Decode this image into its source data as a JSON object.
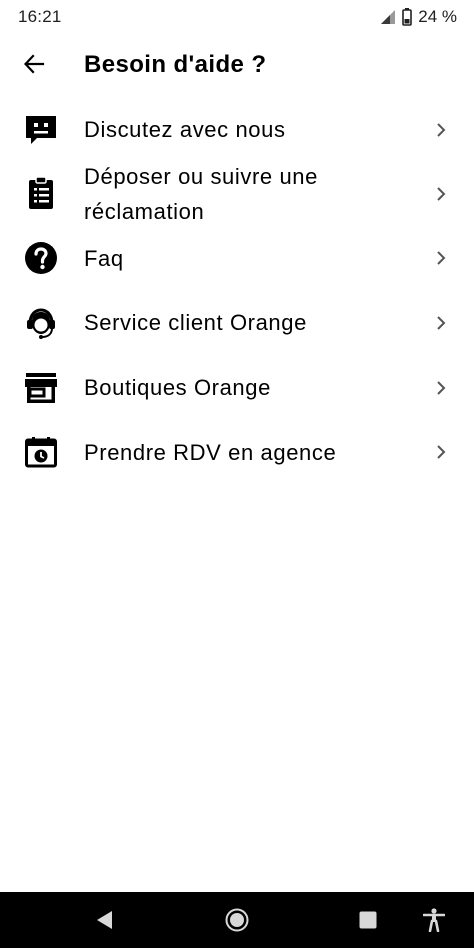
{
  "status_bar": {
    "time": "16:21",
    "battery_percent": "24 %",
    "icons": [
      "signal-icon",
      "battery-icon"
    ]
  },
  "header": {
    "title": "Besoin d'aide ?",
    "back_icon": "arrow-left-icon"
  },
  "menu": {
    "items": [
      {
        "label": "Discutez avec nous",
        "icon": "chat-bubble-icon"
      },
      {
        "label": "Déposer ou suivre une réclamation",
        "icon": "clipboard-icon"
      },
      {
        "label": "Faq",
        "icon": "help-circle-icon"
      },
      {
        "label": "Service client Orange",
        "icon": "headset-agent-icon"
      },
      {
        "label": "Boutiques Orange",
        "icon": "store-icon"
      },
      {
        "label": "Prendre RDV en agence",
        "icon": "calendar-clock-icon"
      }
    ],
    "chevron_icon": "chevron-right-icon"
  },
  "nav_bar": {
    "icons": [
      "back-triangle-icon",
      "home-circle-icon",
      "recents-square-icon",
      "accessibility-icon"
    ]
  },
  "colors": {
    "background": "#ffffff",
    "text": "#000000",
    "nav_bar": "#000000",
    "nav_icon": "#d8d8d8",
    "chevron": "#555555"
  }
}
